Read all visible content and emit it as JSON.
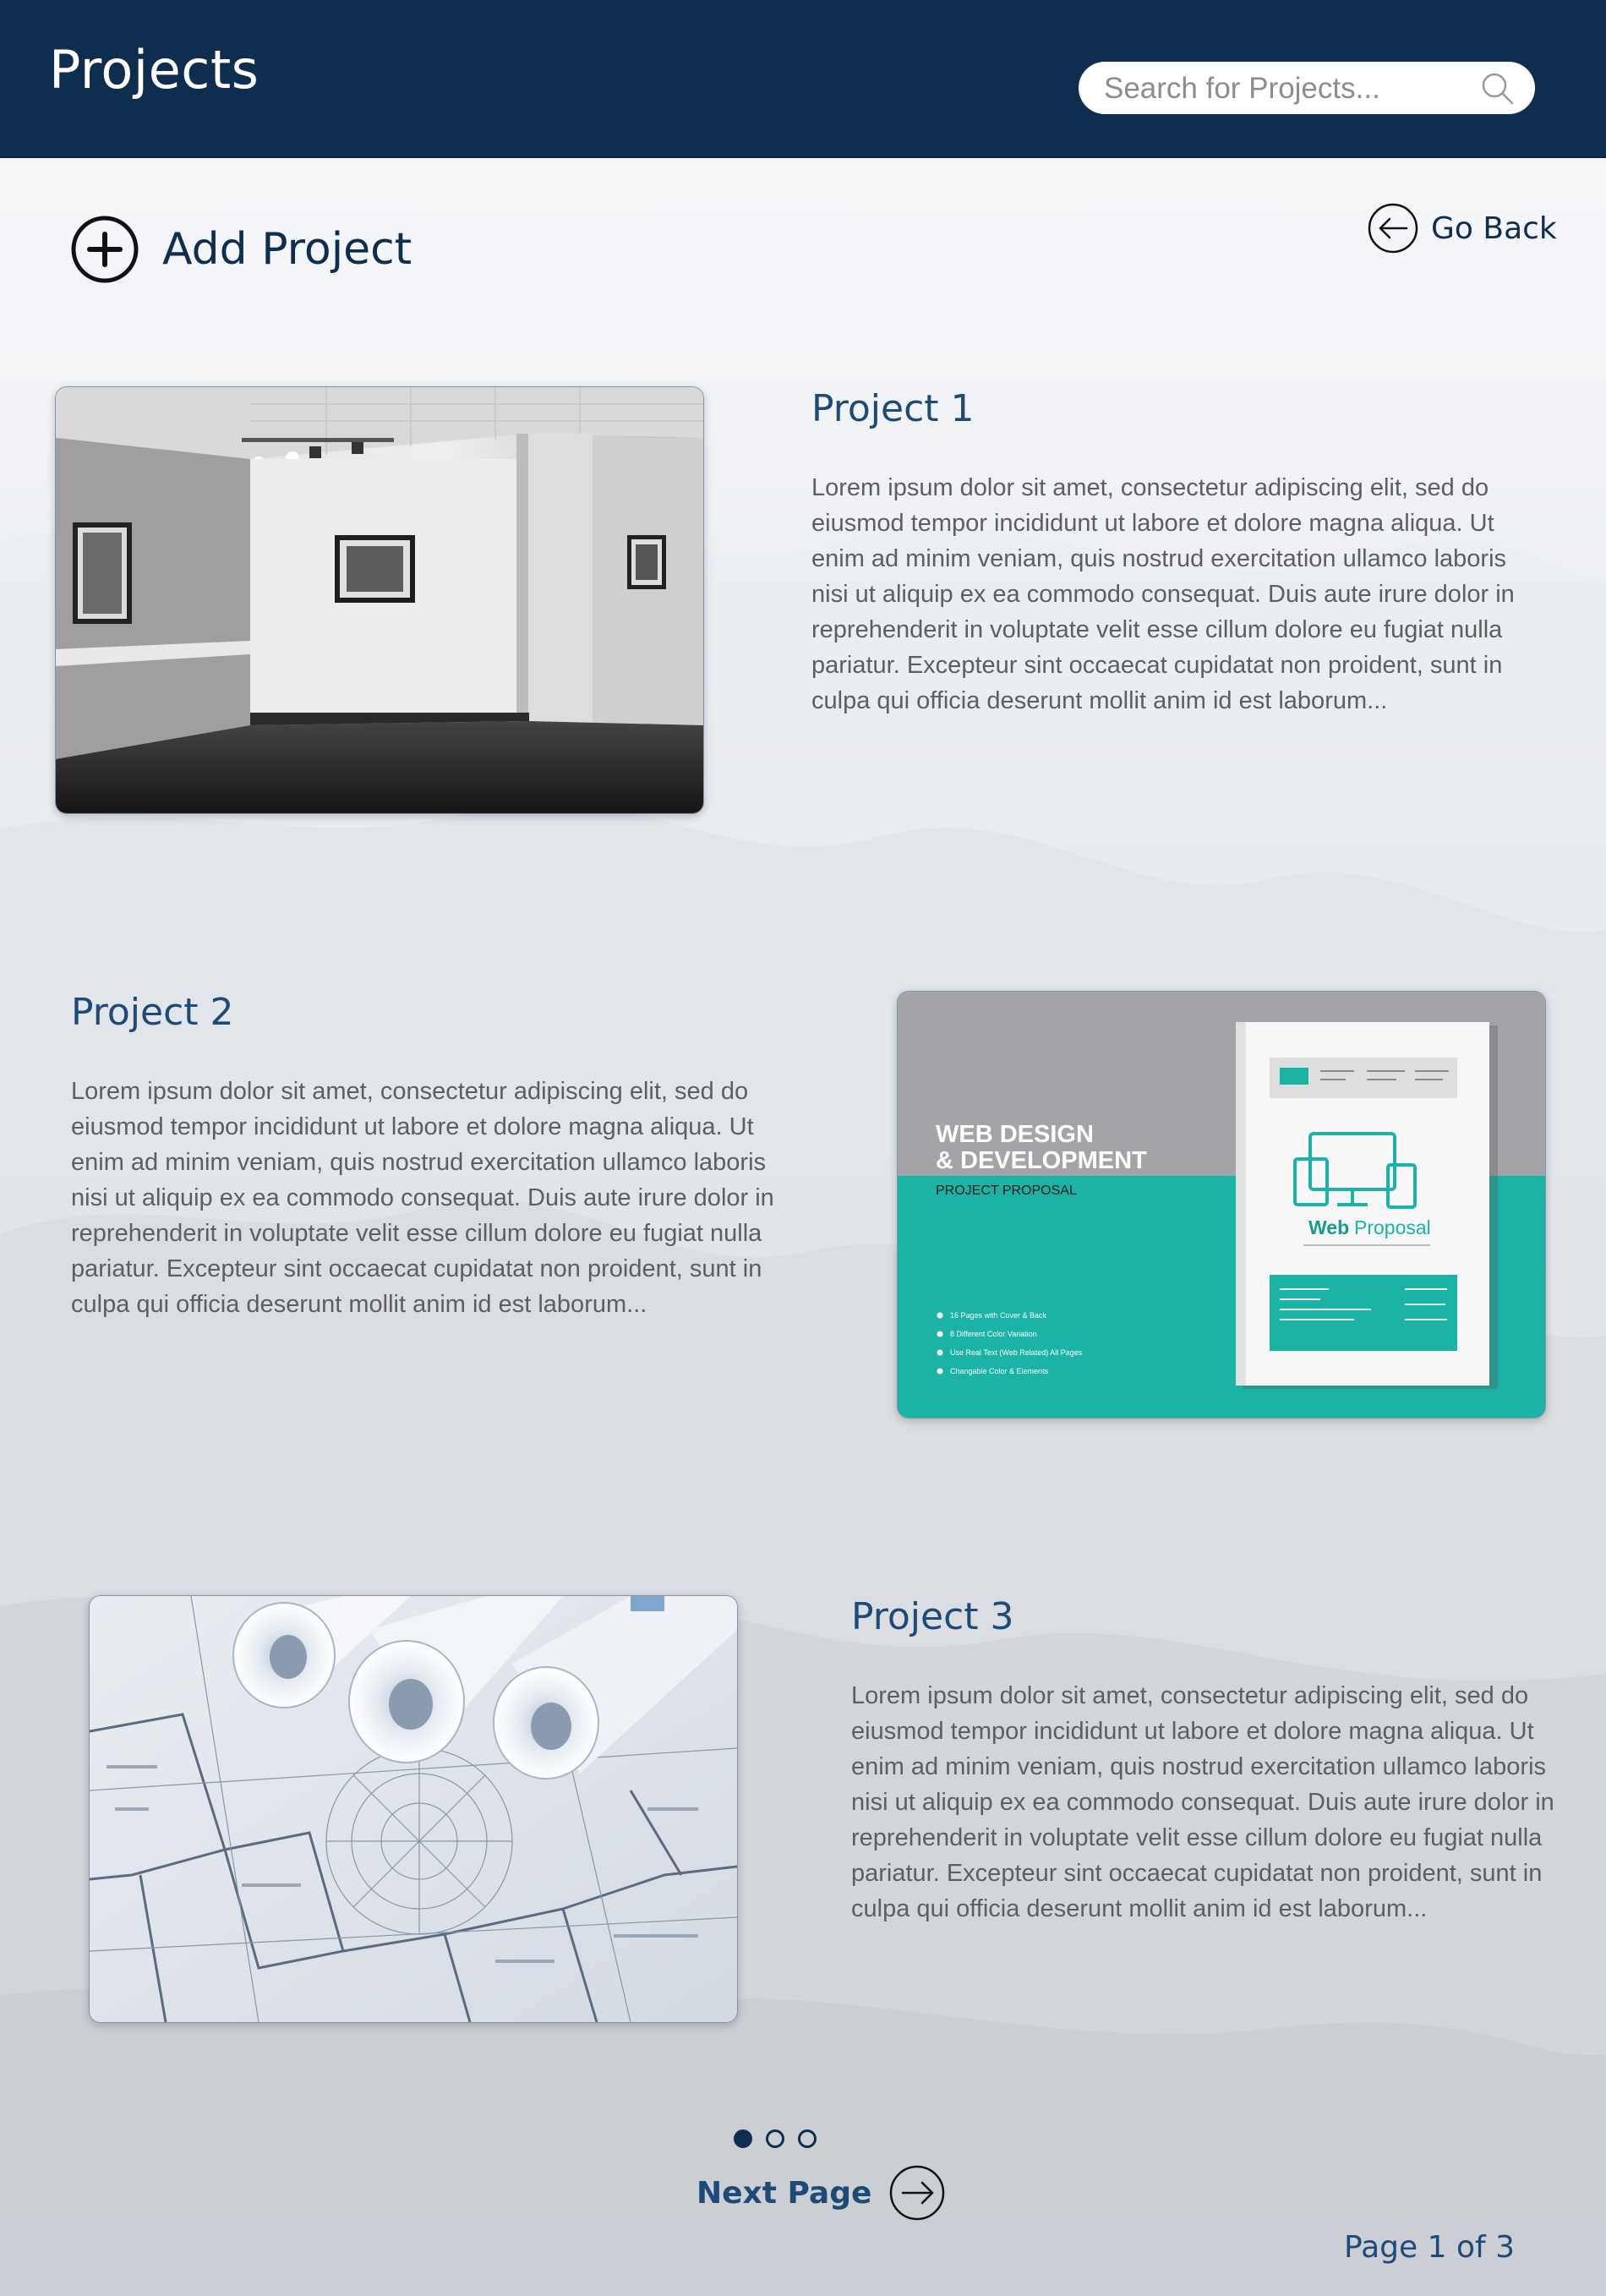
{
  "header": {
    "title": "Projects",
    "search_placeholder": "Search for Projects..."
  },
  "actions": {
    "add_project": "Add Project",
    "go_back": "Go Back"
  },
  "projects": [
    {
      "title": "Project 1",
      "description": "Lorem ipsum dolor sit amet, consectetur adipiscing elit, sed do eiusmod tempor incididunt ut labore et dolore magna aliqua. Ut enim ad minim veniam, quis nostrud exercitation ullamco laboris nisi ut aliquip ex ea commodo consequat. Duis aute irure dolor in reprehenderit in voluptate velit esse cillum dolore eu fugiat nulla pariatur. Excepteur sint occaecat cupidatat non proident, sunt in culpa qui officia deserunt mollit anim id est laborum...",
      "image": "art-gallery-photo"
    },
    {
      "title": "Project 2",
      "description": "Lorem ipsum dolor sit amet, consectetur adipiscing elit, sed do eiusmod tempor incididunt ut labore et dolore magna aliqua. Ut enim ad minim veniam, quis nostrud exercitation ullamco laboris nisi ut aliquip ex ea commodo consequat. Duis aute irure dolor in reprehenderit in voluptate velit esse cillum dolore eu fugiat nulla pariatur. Excepteur sint occaecat cupidatat non proident, sunt in culpa qui officia deserunt mollit anim id est laborum...",
      "image": "web-design-proposal-cover",
      "image_text": {
        "heading_1": "WEB DESIGN",
        "heading_2": "& DEVELOPMENT",
        "subheading": "PROJECT PROPOSAL",
        "brochure_title_1": "Web",
        "brochure_title_2": "Proposal",
        "bullets": [
          "16 Pages with Cover & Back",
          "8 Different Color Variation",
          "Use Real Text (Web Related) All Pages",
          "Changable Color & Elements"
        ]
      }
    },
    {
      "title": "Project 3",
      "description": "Lorem ipsum dolor sit amet, consectetur adipiscing elit, sed do eiusmod tempor incididunt ut labore et dolore magna aliqua. Ut enim ad minim veniam, quis nostrud exercitation ullamco laboris nisi ut aliquip ex ea commodo consequat. Duis aute irure dolor in reprehenderit in voluptate velit esse cillum dolore eu fugiat nulla pariatur. Excepteur sint occaecat cupidatat non proident, sunt in culpa qui officia deserunt mollit anim id est laborum...",
      "image": "architectural-blueprints-photo"
    }
  ],
  "pagination": {
    "dots_total": 3,
    "active_dot": 1,
    "next_label": "Next Page",
    "page_indicator": "Page 1 of 3"
  },
  "colors": {
    "header_bg": "#0f2d4f",
    "title_blue": "#1e4a78",
    "body_text": "#5e5e5e",
    "teal_accent": "#1ab3a6"
  }
}
